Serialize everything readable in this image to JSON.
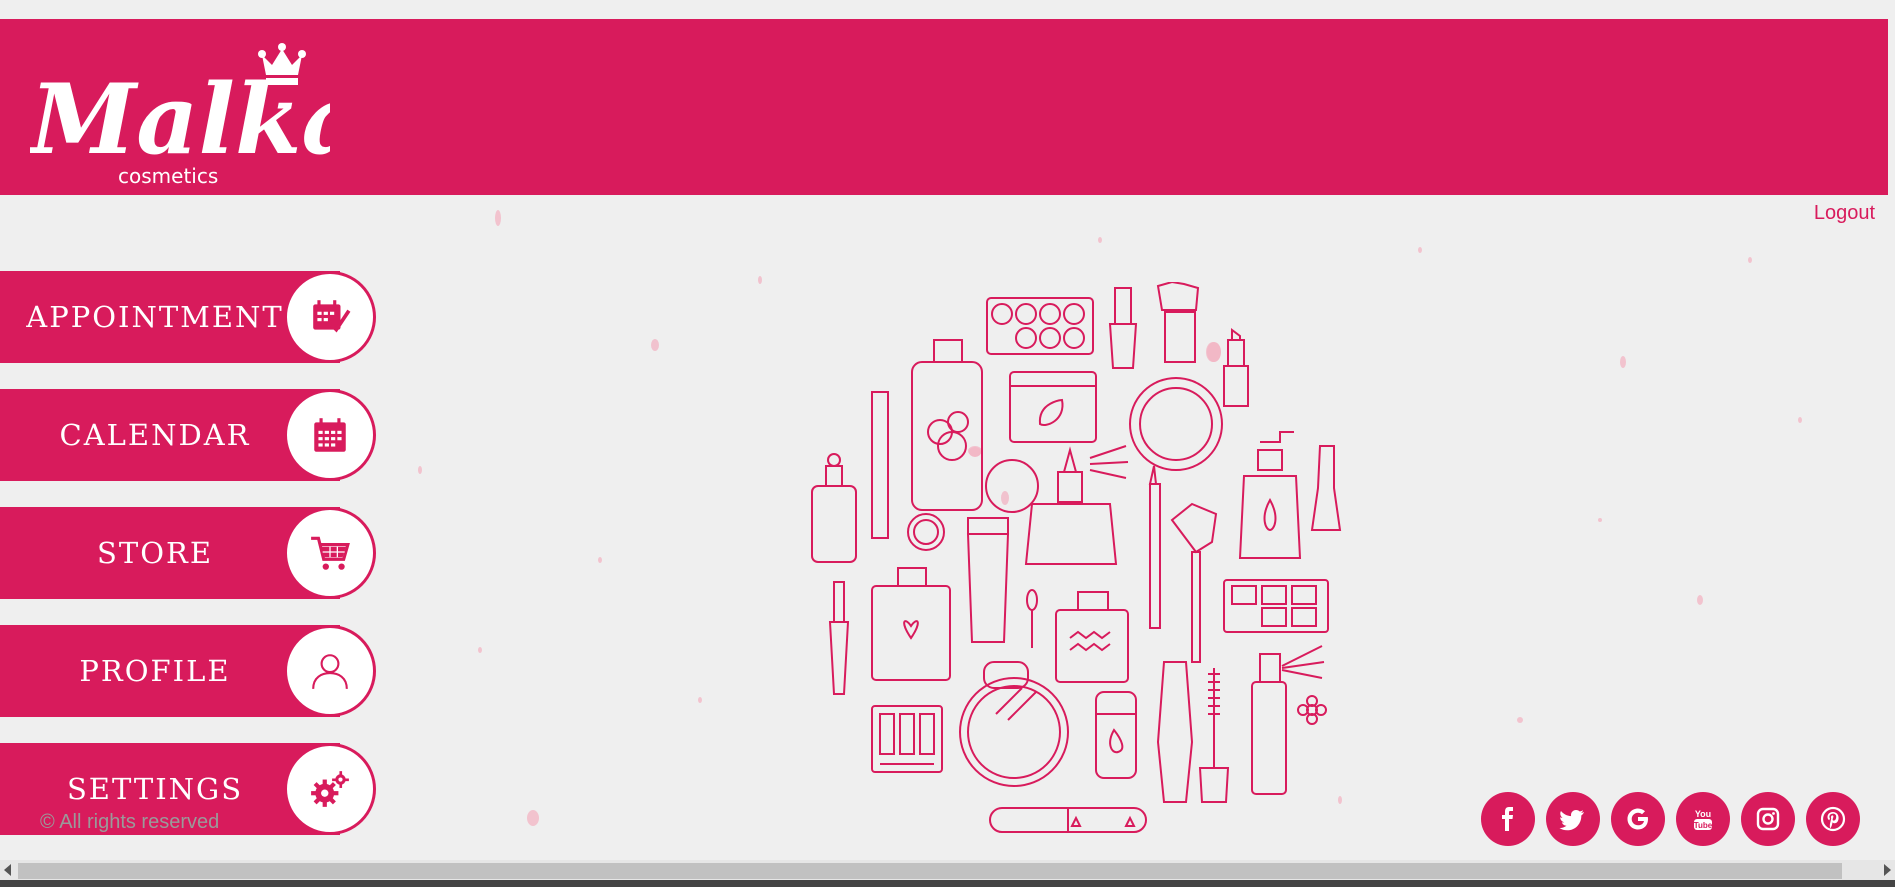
{
  "brand": {
    "name": "Malka",
    "tagline": "cosmetics",
    "color": "#d81b5c"
  },
  "header": {
    "logout_label": "Logout"
  },
  "menu": {
    "items": [
      {
        "label": "APPOINTMENT",
        "icon": "calendar-check-icon"
      },
      {
        "label": "CALENDAR",
        "icon": "calendar-icon"
      },
      {
        "label": "STORE",
        "icon": "cart-icon"
      },
      {
        "label": "PROFILE",
        "icon": "user-icon"
      },
      {
        "label": "SETTINGS",
        "icon": "gears-icon"
      }
    ]
  },
  "footer": {
    "copyright": "© All rights reserved",
    "social": [
      {
        "name": "facebook-icon"
      },
      {
        "name": "twitter-icon"
      },
      {
        "name": "google-icon"
      },
      {
        "name": "youtube-icon"
      },
      {
        "name": "instagram-icon"
      },
      {
        "name": "pinterest-icon"
      }
    ]
  },
  "illustration": {
    "icon": "cosmetics-illustration"
  }
}
